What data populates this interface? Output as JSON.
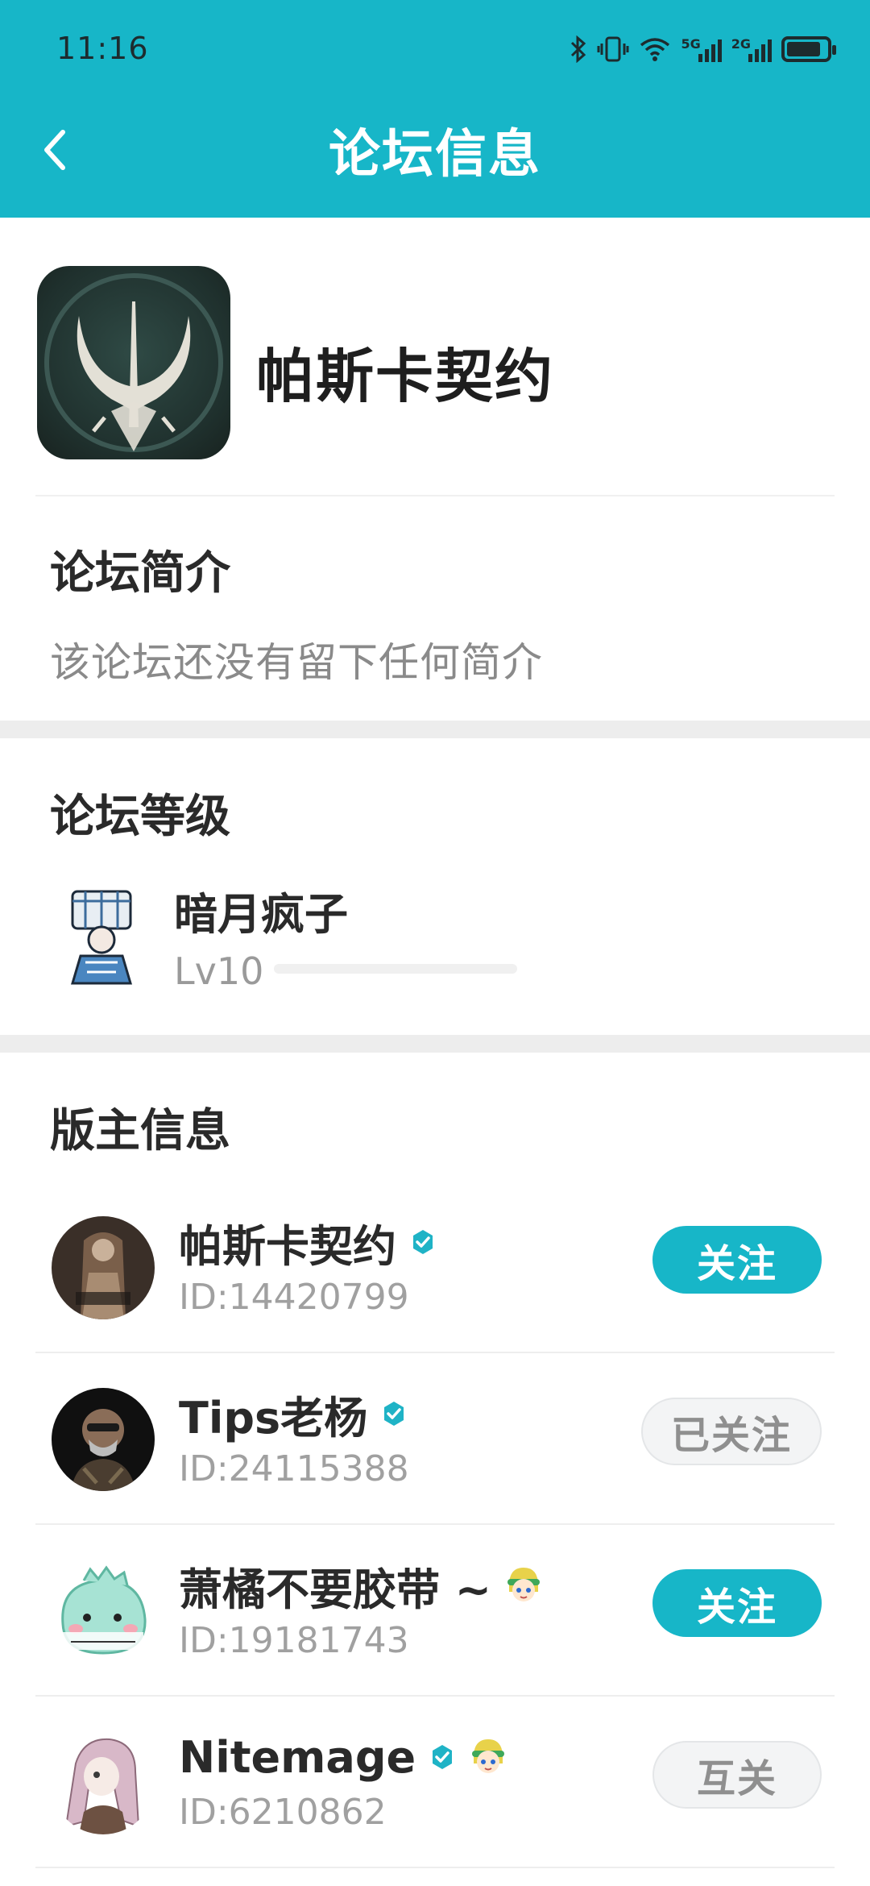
{
  "status_bar": {
    "time": "11:16",
    "network_5g": "5G",
    "network_2g": "2G",
    "battery_level": 0.85
  },
  "header": {
    "title": "论坛信息",
    "back_icon": "chevron-left-icon"
  },
  "forum": {
    "name": "帕斯卡契约"
  },
  "intro": {
    "title": "论坛简介",
    "text": "该论坛还没有留下任何简介"
  },
  "level": {
    "title": "论坛等级",
    "name": "暗月疯子",
    "lv": "Lv10",
    "progress": 0.0
  },
  "moderators": {
    "title": "版主信息",
    "items": [
      {
        "name": "帕斯卡契约",
        "id": "ID:14420799",
        "verified": true,
        "follow_label": "关注",
        "follow_state": "follow"
      },
      {
        "name": "Tips老杨",
        "id": "ID:24115388",
        "verified": true,
        "follow_label": "已关注",
        "follow_state": "followed"
      },
      {
        "name": "萧橘不要胶带 ~",
        "id": "ID:19181743",
        "verified": false,
        "follow_label": "关注",
        "follow_state": "follow"
      },
      {
        "name": "Nitemage",
        "id": "ID:6210862",
        "verified": true,
        "follow_label": "互关",
        "follow_state": "mutual"
      }
    ]
  },
  "colors": {
    "accent": "#17b6c8",
    "verify": "#1fb3c6"
  }
}
